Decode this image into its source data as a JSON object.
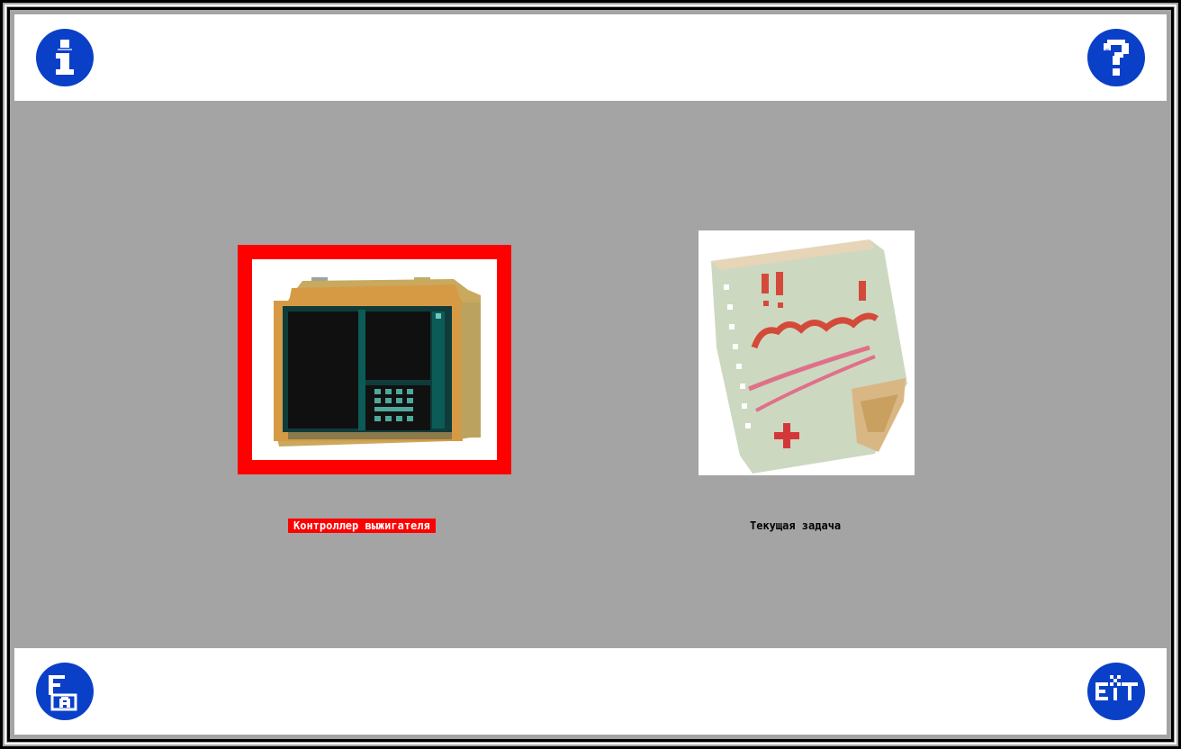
{
  "toolbar": {
    "info_icon": "info-icon",
    "help_icon": "help-icon",
    "fa_icon": "fa-icon",
    "exit_icon": "exit-icon"
  },
  "items": [
    {
      "label": "Контроллер выжигателя",
      "icon": "controller-device-icon",
      "selected": true
    },
    {
      "label": "Текущая задача",
      "icon": "task-note-icon",
      "selected": false
    }
  ],
  "colors": {
    "accent": "#0a3fc8",
    "selection": "#ff0000",
    "background": "#a4a4a4"
  }
}
